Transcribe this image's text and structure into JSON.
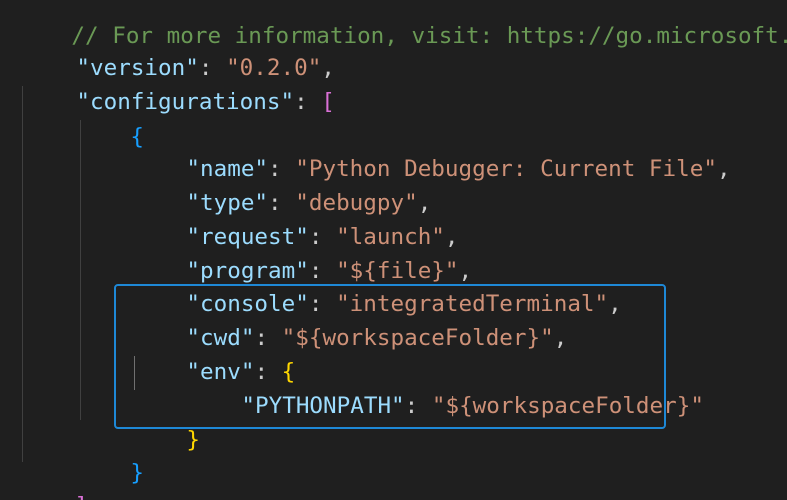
{
  "editor": {
    "comment": "// For more information, visit: https://go.microsoft.com",
    "lines": {
      "l1": {
        "key": "\"version\"",
        "value": "\"0.2.0\""
      },
      "l2": {
        "key": "\"configurations\"",
        "bracket": "["
      },
      "l3": {
        "brace": "{"
      },
      "l4": {
        "key": "\"name\"",
        "value": "\"Python Debugger: Current File\""
      },
      "l5": {
        "key": "\"type\"",
        "value": "\"debugpy\""
      },
      "l6": {
        "key": "\"request\"",
        "value": "\"launch\""
      },
      "l7": {
        "key": "\"program\"",
        "value": "\"${file}\""
      },
      "l8": {
        "key": "\"console\"",
        "value": "\"integratedTerminal\""
      },
      "l9": {
        "key": "\"cwd\"",
        "value": "\"${workspaceFolder}\""
      },
      "l10": {
        "key": "\"env\"",
        "brace": "{"
      },
      "l11": {
        "key": "\"PYTHONPATH\"",
        "value": "\"${workspaceFolder}\""
      },
      "l12": {
        "brace": "}"
      },
      "l13": {
        "brace": "}"
      },
      "l14": {
        "bracket": "]"
      }
    }
  },
  "colors": {
    "background": "#1f1f1f",
    "key": "#9cdcfe",
    "string": "#ce9178",
    "bracket_level1": "#ffd700",
    "bracket_level2": "#da70d6",
    "bracket_level3": "#179fff",
    "highlight_box": "#1e88d6"
  }
}
